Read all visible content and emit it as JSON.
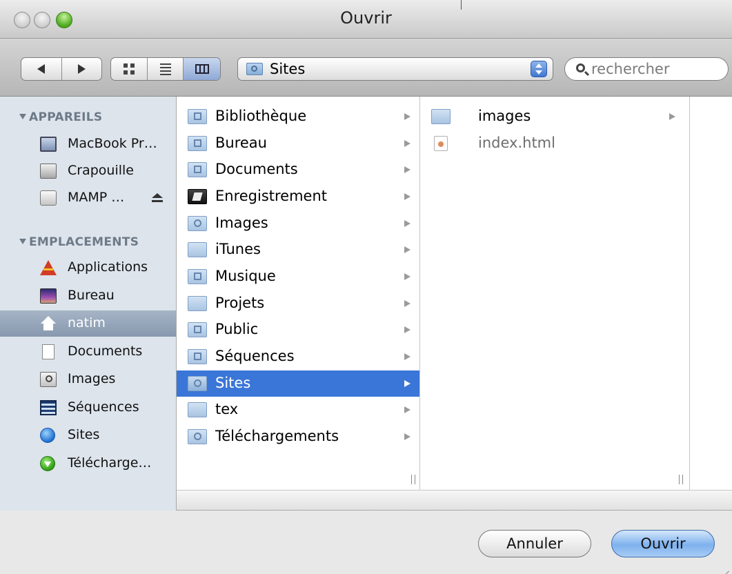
{
  "window": {
    "title": "Ouvrir"
  },
  "toolbar": {
    "location": "Sites",
    "search_placeholder": "rechercher"
  },
  "sidebar": {
    "sections": [
      {
        "label": "APPAREILS",
        "items": [
          {
            "label": "MacBook Pr…",
            "icon": "laptop-icon"
          },
          {
            "label": "Crapouille",
            "icon": "hard-drive-icon"
          },
          {
            "label": "MAMP …",
            "icon": "disk-image-icon",
            "eject": true
          }
        ]
      },
      {
        "label": "EMPLACEMENTS",
        "items": [
          {
            "label": "Applications",
            "icon": "applications-icon"
          },
          {
            "label": "Bureau",
            "icon": "desktop-icon"
          },
          {
            "label": "natim",
            "icon": "home-icon",
            "selected": true
          },
          {
            "label": "Documents",
            "icon": "documents-icon"
          },
          {
            "label": "Images",
            "icon": "pictures-icon"
          },
          {
            "label": "Séquences",
            "icon": "movies-icon"
          },
          {
            "label": "Sites",
            "icon": "globe-icon"
          },
          {
            "label": "Télécharge…",
            "icon": "downloads-icon"
          }
        ]
      }
    ]
  },
  "columns": [
    {
      "items": [
        {
          "label": "Bibliothèque"
        },
        {
          "label": "Bureau"
        },
        {
          "label": "Documents"
        },
        {
          "label": "Enregistrement"
        },
        {
          "label": "Images"
        },
        {
          "label": "iTunes"
        },
        {
          "label": "Musique"
        },
        {
          "label": "Projets"
        },
        {
          "label": "Public"
        },
        {
          "label": "Séquences"
        },
        {
          "label": "Sites",
          "selected": true
        },
        {
          "label": "tex"
        },
        {
          "label": "Téléchargements"
        }
      ]
    },
    {
      "items": [
        {
          "label": "images"
        },
        {
          "label": "index.html"
        }
      ]
    }
  ],
  "buttons": {
    "cancel": "Annuler",
    "open": "Ouvrir"
  },
  "colors": {
    "selection": "#3a76d7",
    "sidebar_bg": "#dde4ec",
    "sidebar_selection": "#8798ae"
  }
}
